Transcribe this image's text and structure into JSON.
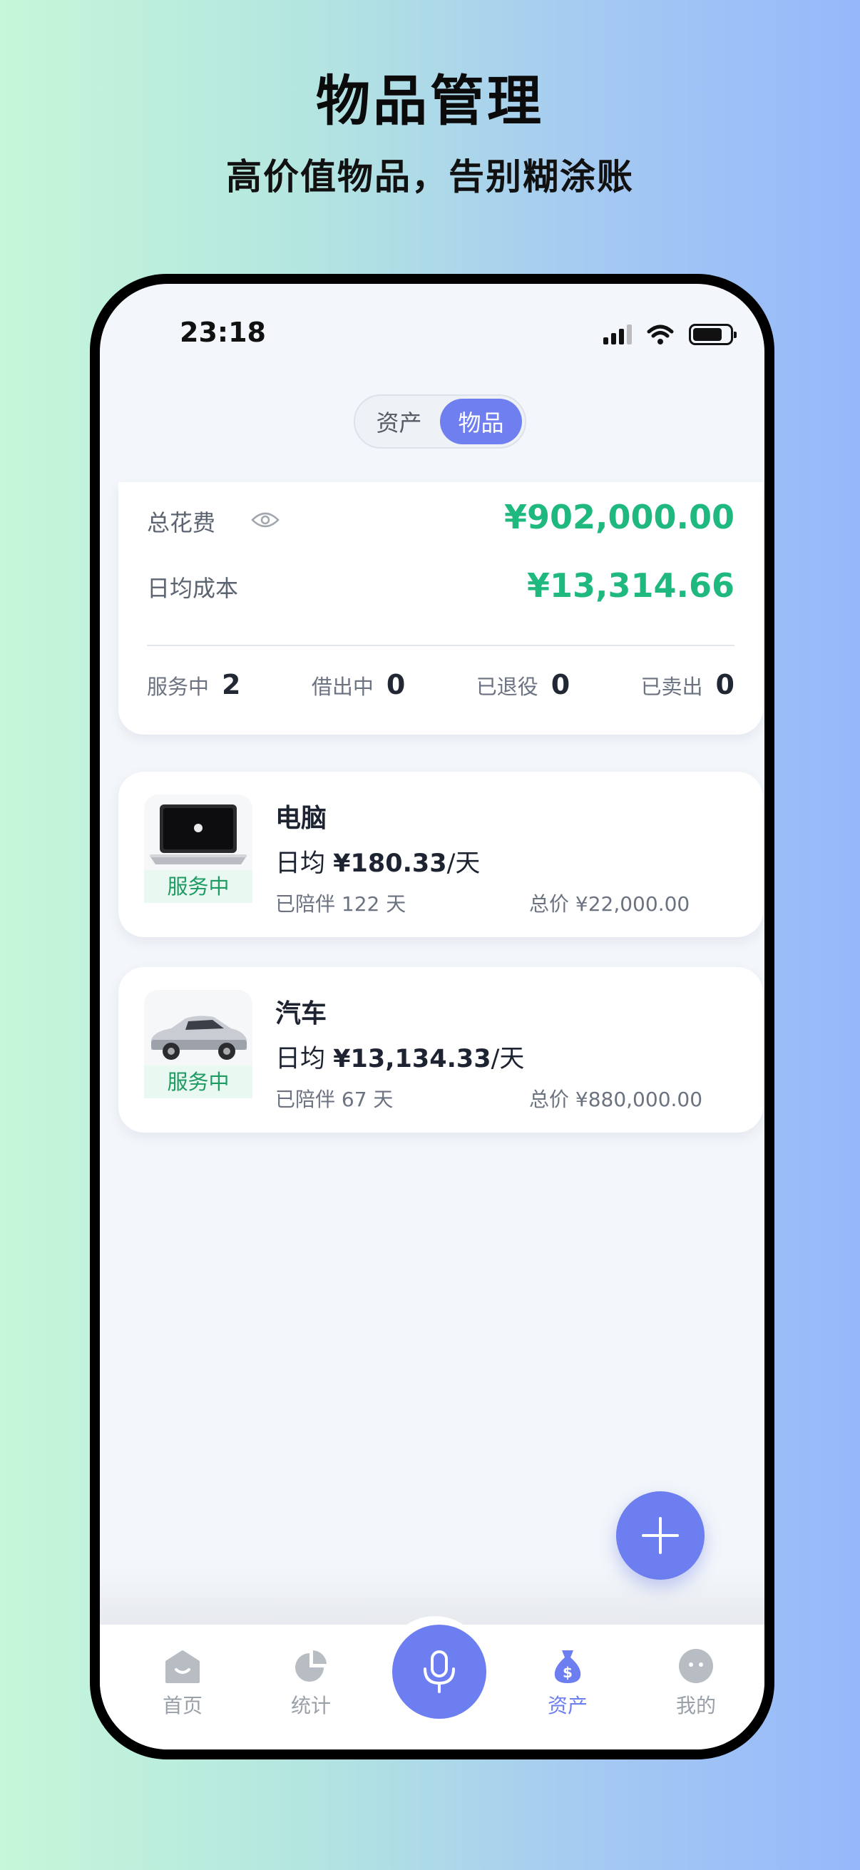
{
  "promo": {
    "title": "物品管理",
    "subtitle": "高价值物品，告别糊涂账"
  },
  "status_bar": {
    "time": "23:18"
  },
  "segment": {
    "tabs": [
      {
        "label": "资产",
        "active": false
      },
      {
        "label": "物品",
        "active": true
      }
    ]
  },
  "summary": {
    "total_label": "总花费",
    "total_value": "¥902,000.00",
    "daily_label": "日均成本",
    "daily_value": "¥13,314.66",
    "stats": [
      {
        "label": "服务中",
        "value": "2"
      },
      {
        "label": "借出中",
        "value": "0"
      },
      {
        "label": "已退役",
        "value": "0"
      },
      {
        "label": "已卖出",
        "value": "0"
      }
    ]
  },
  "items": [
    {
      "name": "电脑",
      "status": "服务中",
      "daily_prefix": "日均",
      "daily_value": "¥180.33",
      "daily_suffix": "/天",
      "days": "已陪伴 122 天",
      "total": "总价 ¥22,000.00",
      "image": "laptop"
    },
    {
      "name": "汽车",
      "status": "服务中",
      "daily_prefix": "日均",
      "daily_value": "¥13,134.33",
      "daily_suffix": "/天",
      "days": "已陪伴 67 天",
      "total": "总价 ¥880,000.00",
      "image": "car"
    }
  ],
  "tabbar": {
    "tabs": [
      {
        "label": "首页",
        "icon": "home-icon",
        "active": false
      },
      {
        "label": "统计",
        "icon": "pie-chart-icon",
        "active": false
      },
      {
        "label": "资产",
        "icon": "money-bag-icon",
        "active": true
      },
      {
        "label": "我的",
        "icon": "profile-icon",
        "active": false
      }
    ],
    "center_icon": "microphone-icon"
  },
  "colors": {
    "accent": "#6d7ef0",
    "money_green": "#1fb87f",
    "status_green": "#1e9a63"
  }
}
